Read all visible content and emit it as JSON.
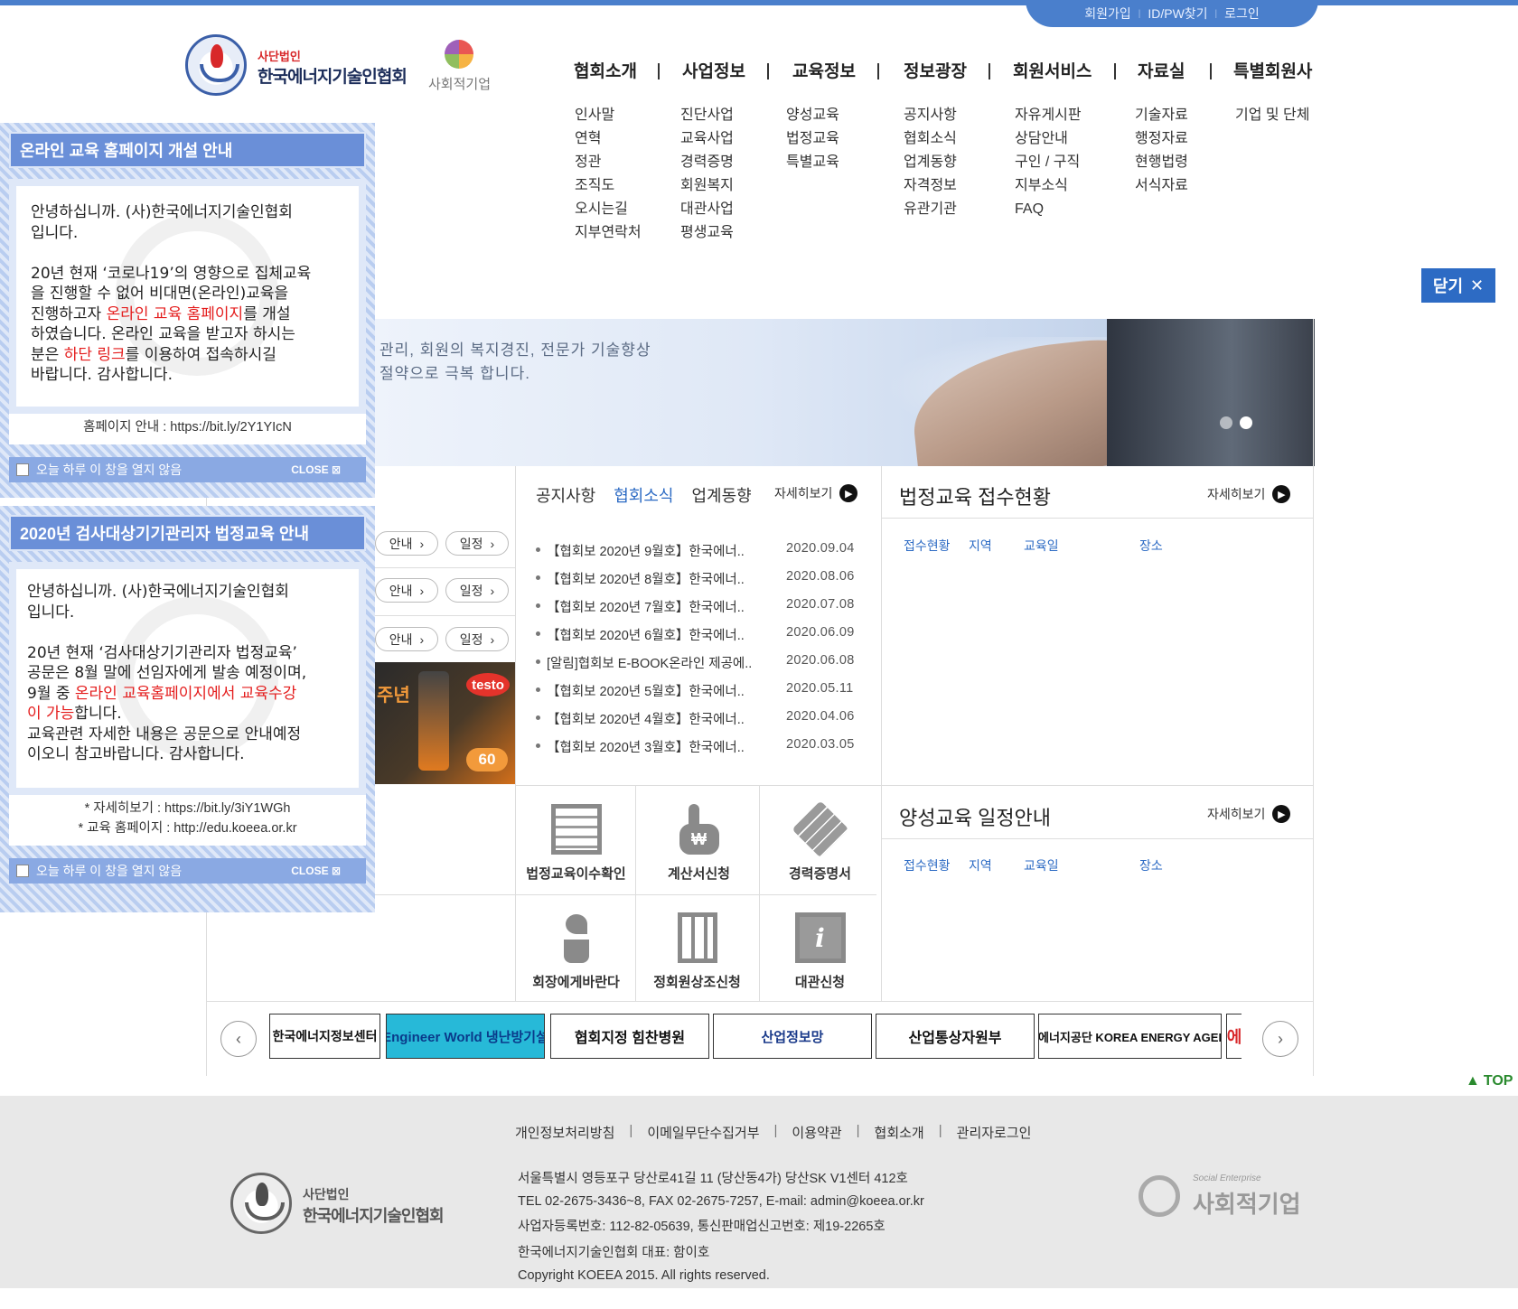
{
  "util_links": [
    "회원가입",
    "ID/PW찾기",
    "로그인"
  ],
  "logo": {
    "sub": "사단법인",
    "name": "한국에너지기술인협회",
    "social": "사회적기업"
  },
  "gnb": [
    {
      "label": "협회소개",
      "sub": [
        "인사말",
        "연혁",
        "정관",
        "조직도",
        "오시는길",
        "지부연락처"
      ]
    },
    {
      "label": "사업정보",
      "sub": [
        "진단사업",
        "교육사업",
        "경력증명",
        "회원복지",
        "대관사업",
        "평생교육"
      ]
    },
    {
      "label": "교육정보",
      "sub": [
        "양성교육",
        "법정교육",
        "특별교육"
      ]
    },
    {
      "label": "정보광장",
      "sub": [
        "공지사항",
        "협회소식",
        "업계동향",
        "자격정보",
        "유관기관"
      ]
    },
    {
      "label": "회원서비스",
      "sub": [
        "자유게시판",
        "상담안내",
        "구인 / 구직",
        "지부소식",
        "FAQ"
      ]
    },
    {
      "label": "자료실",
      "sub": [
        "기술자료",
        "행정자료",
        "현행법령",
        "서식자료"
      ]
    },
    {
      "label": "특별회원사",
      "sub": [
        "기업 및 단체"
      ]
    }
  ],
  "close_menu": "닫기",
  "banner": {
    "line1": "관리, 회원의 복지경진, 전문가 기술향상",
    "line2": "절약으로 극복 합니다."
  },
  "pill_labels": {
    "guide": "안내",
    "schedule": "일정"
  },
  "testo": {
    "logo": "testo",
    "year": "주년",
    "badge": "60"
  },
  "notice": {
    "tabs": [
      "공지사항",
      "협회소식",
      "업계동향"
    ],
    "active_tab": 1,
    "more": "자세히보기",
    "items": [
      {
        "title": "【협회보 2020년 9월호】한국에너..",
        "date": "2020.09.04"
      },
      {
        "title": "【협회보 2020년 8월호】한국에너..",
        "date": "2020.08.06"
      },
      {
        "title": "【협회보 2020년 7월호】한국에너..",
        "date": "2020.07.08"
      },
      {
        "title": "【협회보 2020년 6월호】한국에너..",
        "date": "2020.06.09"
      },
      {
        "title": "[알림]협회보 E-BOOK온라인 제공에..",
        "date": "2020.06.08"
      },
      {
        "title": "【협회보 2020년 5월호】한국에너..",
        "date": "2020.05.11"
      },
      {
        "title": "【협회보 2020년 4월호】한국에너..",
        "date": "2020.04.06"
      },
      {
        "title": "【협회보 2020년 3월호】한국에너..",
        "date": "2020.03.05"
      }
    ]
  },
  "legal_edu": {
    "title": "법정교육 접수현황",
    "more": "자세히보기",
    "cols": [
      "접수현황",
      "지역",
      "교육일",
      "장소"
    ]
  },
  "training_edu": {
    "title": "양성교육 일정안내",
    "more": "자세히보기",
    "cols": [
      "접수현황",
      "지역",
      "교육일",
      "장소"
    ]
  },
  "quick_links": [
    {
      "label": "법정교육이수확인",
      "icon": "document-icon"
    },
    {
      "label": "계산서신청",
      "icon": "hand-won-icon"
    },
    {
      "label": "경력증명서",
      "icon": "cube-icon"
    },
    {
      "label": "회장에게바란다",
      "icon": "sprout-icon"
    },
    {
      "label": "정회원상조신청",
      "icon": "building-icon"
    },
    {
      "label": "대관신청",
      "icon": "info-icon"
    }
  ],
  "partners": [
    "한국에너지정보센터",
    "Engineer World 냉난방기설",
    "협회지정 힘찬병원",
    "산업정보망",
    "산업통상자원부",
    "한국에너지공단 KOREA ENERGY AGENCY"
  ],
  "top_label": "TOP",
  "footer": {
    "menu": [
      "개인정보처리방침",
      "이메일무단수집거부",
      "이용약관",
      "협회소개",
      "관리자로그인"
    ],
    "address": "서울특별시 영등포구 당산로41길 11 (당산동4가) 당산SK V1센터 412호",
    "contact": "TEL 02-2675-3436~8, FAX 02-2675-7257, E-mail: admin@koeea.or.kr",
    "business": "사업자등록번호: 112-82-05639, 통신판매업신고번호: 제19-2265호",
    "ceo": "한국에너지기술인협회 대표: 함이호",
    "copyright": "Copyright KOEEA 2015. All rights reserved.",
    "logo_sub": "사단법인",
    "logo_name": "한국에너지기술인협회",
    "social_tag": "Social Enterprise",
    "social_name": "사회적기업"
  },
  "popup1": {
    "title": "온라인 교육 홈페이지 개설 안내",
    "lines": [
      "안녕하십니까. (사)한국에너지기술인협회",
      "입니다.",
      "",
      "20년 현재 ‘코로나19’의 영향으로 집체교육",
      "을 진행할 수 없어 비대면(온라인)교육을"
    ],
    "line_a": "진행하고자 ",
    "red_a": "온라인 교육 홈페이지",
    "line_a2": "를 개설",
    "line_b": "하였습니다. 온라인 교육을 받고자 하시는",
    "line_c": "분은 ",
    "red_c": "하단 링크",
    "line_c2": "를 이용하여 접속하시길",
    "line_d": "바랍니다. 감사합니다.",
    "link": "홈페이지 안내 : https://bit.ly/2Y1YIcN",
    "no_show": "오늘 하루 이 창을 열지 않음",
    "close": "CLOSE"
  },
  "popup2": {
    "title": "2020년 검사대상기기관리자 법정교육 안내",
    "line1": "안녕하십니까. (사)한국에너지기술인협회",
    "line2": "입니다.",
    "line3": " 20년 현재 ‘검사대상기기관리자 법정교육’",
    "line4": "공문은 8월 말에 선임자에게 발송 예정이며,",
    "line5": "9월 중 ",
    "red5": "온라인 교육홈페이지에서 교육수강",
    "red6": "이 가능",
    "line6": "합니다.",
    "line7": "교육관련 자세한 내용은 공문으로 안내예정",
    "line8": "이오니 참고바랍니다. 감사합니다.",
    "link1": "* 자세히보기 : https://bit.ly/3iY1WGh",
    "link2": "* 교육 홈페이지 : http://edu.koeea.or.kr",
    "no_show": "오늘 하루 이 창을 열지 않음",
    "close": "CLOSE"
  }
}
